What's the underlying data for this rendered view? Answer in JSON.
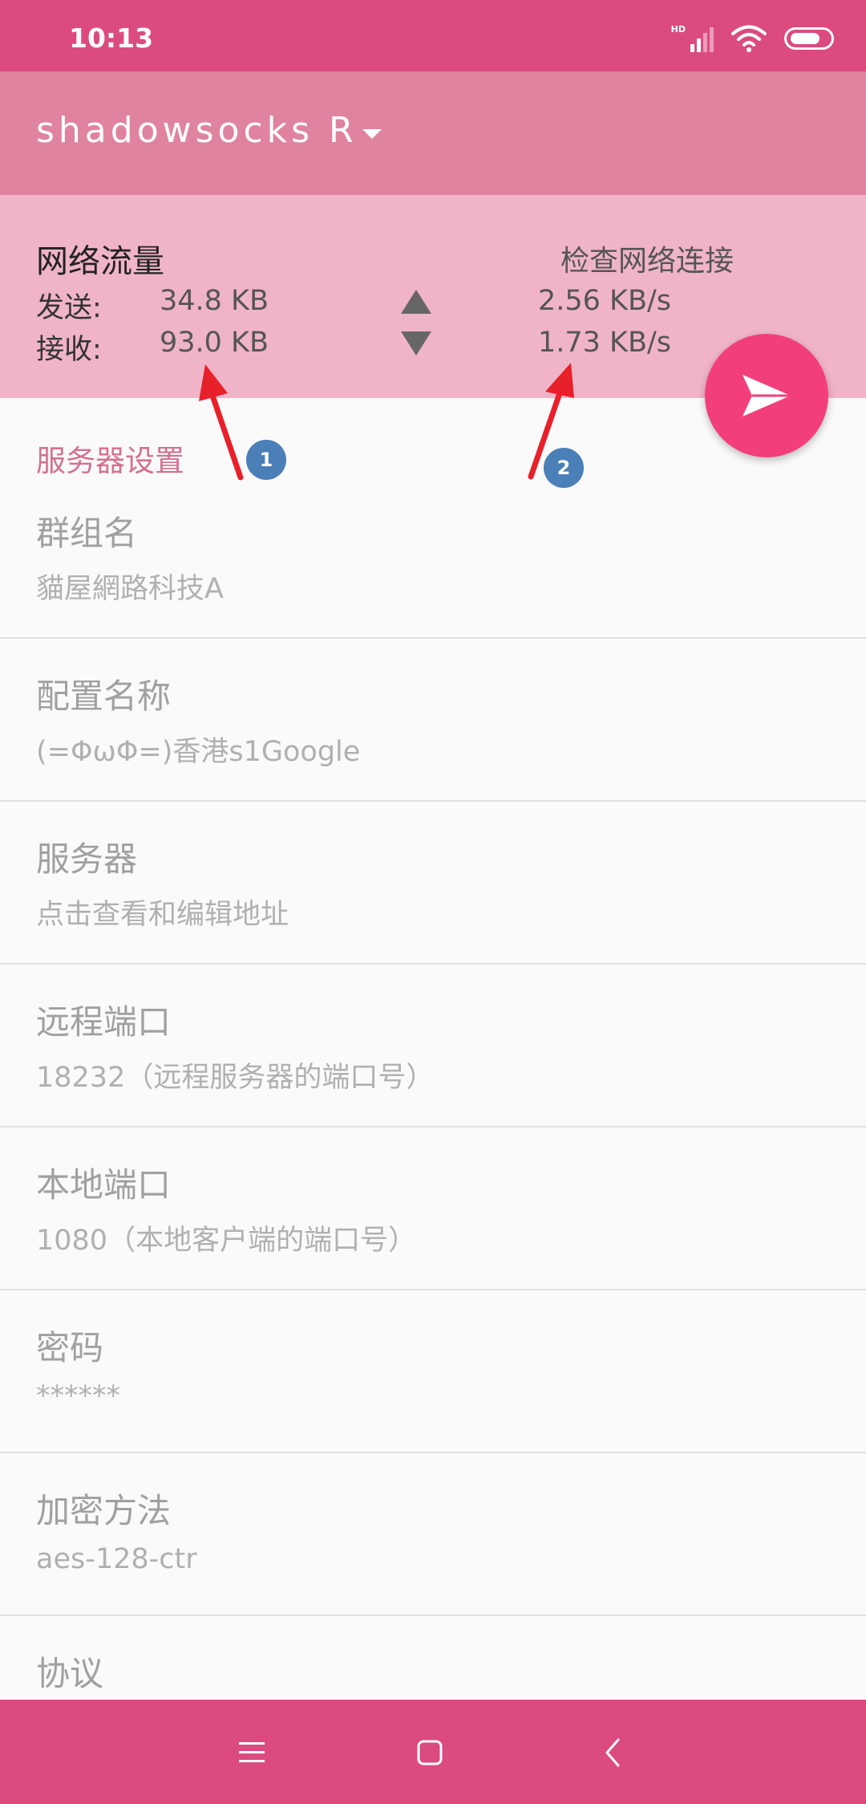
{
  "status_bar": {
    "time": "10:13",
    "signal_label": "HD",
    "icons": [
      "signal-icon",
      "wifi-icon",
      "battery-icon"
    ]
  },
  "toolbar": {
    "title": "shadowsocks R",
    "dropdown_icon": "caret-down-icon"
  },
  "stats": {
    "title": "网络流量",
    "check_link": "检查网络连接",
    "sent_label": "发送:",
    "sent_total": "34.8 KB",
    "sent_rate": "2.56 KB/s",
    "recv_label": "接收:",
    "recv_total": "93.0 KB",
    "recv_rate": "1.73 KB/s"
  },
  "fab": {
    "icon": "paper-plane-icon"
  },
  "section": {
    "header": "服务器设置"
  },
  "preferences": [
    {
      "title": "群组名",
      "summary": "貓屋網路科技A"
    },
    {
      "title": "配置名称",
      "summary": "(=ΦωΦ=)香港s1Google"
    },
    {
      "title": "服务器",
      "summary": "点击查看和编辑地址"
    },
    {
      "title": "远程端口",
      "summary": "18232（远程服务器的端口号）"
    },
    {
      "title": "本地端口",
      "summary": "1080（本地客户端的端口号）"
    },
    {
      "title": "密码",
      "summary": "******"
    },
    {
      "title": "加密方法",
      "summary": "aes-128-ctr"
    },
    {
      "title": "协议",
      "summary": ""
    }
  ],
  "annotations": [
    "1",
    "2"
  ],
  "colors": {
    "status_bar": "#db4b7f",
    "toolbar": "#e0839f",
    "stats_panel": "#f0b4c9",
    "fab": "#f23f7b",
    "section_header": "#d4708f",
    "annotation_arrow": "#e8202a",
    "annotation_badge": "#4a7fb8"
  },
  "nav_bar": {
    "icons": [
      "menu-icon",
      "home-icon",
      "back-icon"
    ]
  }
}
